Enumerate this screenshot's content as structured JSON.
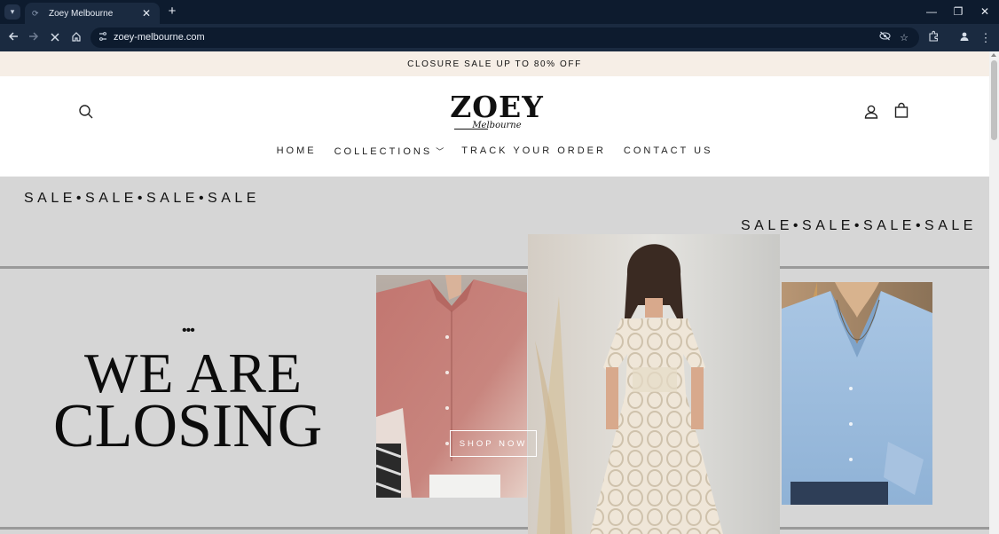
{
  "browser": {
    "tab_title": "Zoey Melbourne",
    "url": "zoey-melbourne.com"
  },
  "announcement": "CLOSURE SALE UP TO 80% OFF",
  "logo": {
    "main": "ZOEY",
    "sub": "Melbourne"
  },
  "nav": {
    "home": "HOME",
    "collections": "COLLECTIONS",
    "track": "TRACK YOUR ORDER",
    "contact": "CONTACT US"
  },
  "hero": {
    "sale_left": "SALE•SALE•SALE•SALE",
    "sale_right": "SALE•SALE•SALE•SALE",
    "dots": "•••",
    "line1": "WE ARE",
    "line2": "CLOSING",
    "cta": "SHOP NOW"
  },
  "colors": {
    "announcement_bg": "#f6eee6",
    "hero_bg": "#d6d6d6",
    "chrome_dark": "#0d1b2e",
    "chrome_toolbar": "#1a2a40"
  }
}
